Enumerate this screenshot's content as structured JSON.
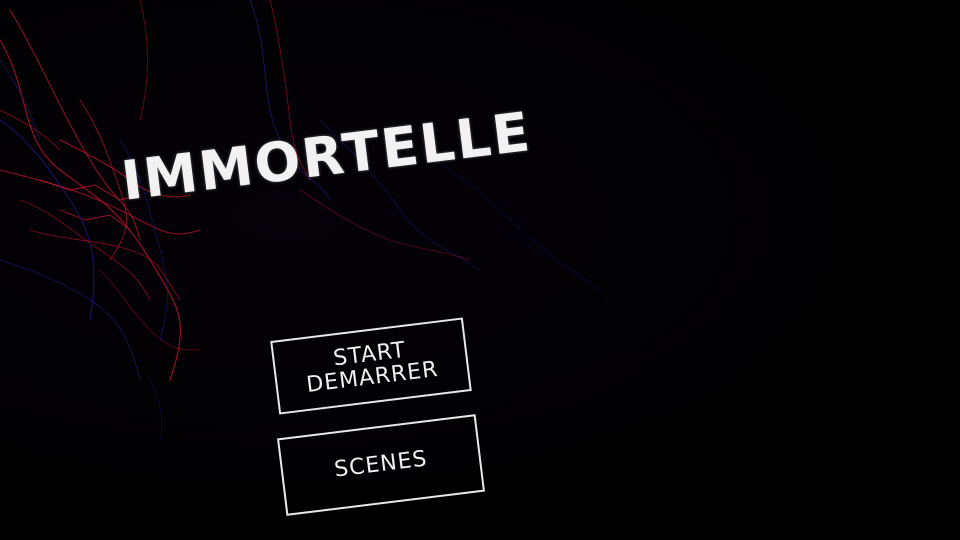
{
  "game": {
    "title": "IMMORTELLE"
  },
  "menu": {
    "start": {
      "line1": "START",
      "line2": "DEMARRER"
    },
    "scenes": {
      "label": "SCENES"
    }
  },
  "colors": {
    "background": "#000000",
    "text": "#f2f2f2",
    "vein_red": "#c0102a",
    "vein_blue": "#2a1a8a"
  }
}
